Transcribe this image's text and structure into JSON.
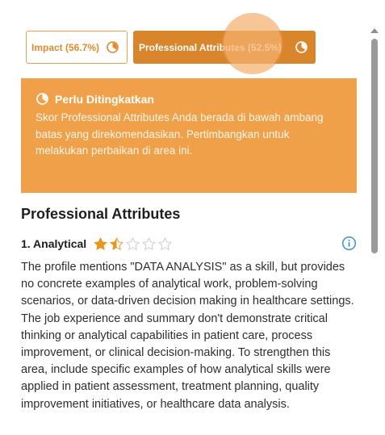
{
  "tabs": [
    {
      "label": "Impact (56.7%)",
      "icon": "progress-clock-icon",
      "active": false
    },
    {
      "label": "Professional Attributes (52.5%)",
      "icon": "progress-clock-icon",
      "active": true
    }
  ],
  "alert": {
    "icon": "progress-clock-icon",
    "title": "Perlu Ditingkatkan",
    "body": "Skor Professional Attributes Anda berada di bawah ambang batas yang direkomendasikan. Pertimbangkan untuk melakukan perbaikan di area ini."
  },
  "section": {
    "title": "Professional Attributes"
  },
  "items": [
    {
      "title": "1. Analytical",
      "rating": 1.5,
      "rating_max": 5,
      "info_icon": "info-icon",
      "body": "The profile mentions \"DATA ANALYSIS\" as a skill, but provides no concrete examples of analytical work, problem-solving scenarios, or data-driven decision making in healthcare settings. The job experience and summary don't demonstrate critical thinking or analytical capabilities in patient care, process improvement, or clinical decision-making. To strengthen this area, include specific examples of how analytical skills were applied in patient assessment, treatment planning, quality improvement initiatives, or healthcare data analysis."
    }
  ],
  "colors": {
    "accent": "#d9852c",
    "accent_light": "#f0a048",
    "star": "#e8961e",
    "info": "#3a8fd8"
  }
}
